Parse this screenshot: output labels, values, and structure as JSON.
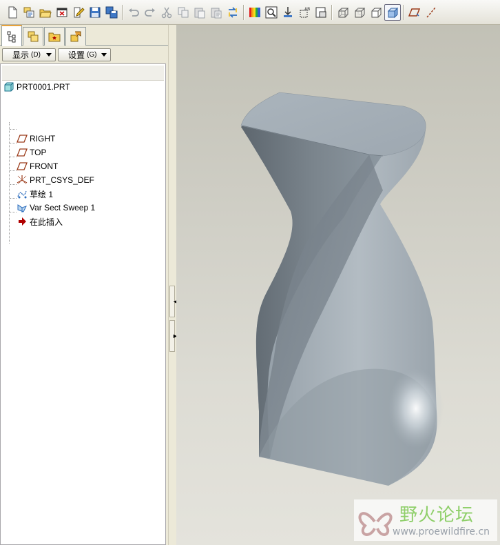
{
  "toolbar": {
    "buttons": [
      {
        "name": "new-icon"
      },
      {
        "name": "open-icon"
      },
      {
        "name": "open-folder-icon"
      },
      {
        "name": "close-window-icon"
      },
      {
        "name": "edit-icon"
      },
      {
        "name": "save-icon"
      },
      {
        "name": "save-copy-icon"
      },
      {
        "name": "undo-icon"
      },
      {
        "name": "redo-icon"
      },
      {
        "name": "cut-icon"
      },
      {
        "name": "copy-icon"
      },
      {
        "name": "paste-icon"
      },
      {
        "name": "paste-special-icon"
      },
      {
        "name": "regenerate-icon"
      },
      {
        "name": "color-appearance-icon"
      },
      {
        "name": "zoom-window-icon"
      },
      {
        "name": "zoom-in-icon"
      },
      {
        "name": "view-manager-icon"
      },
      {
        "name": "saved-views-icon"
      },
      {
        "name": "wireframe-icon"
      },
      {
        "name": "hidden-line-icon"
      },
      {
        "name": "no-hidden-icon"
      },
      {
        "name": "shading-icon",
        "active": true
      },
      {
        "name": "datum-plane-display-icon"
      }
    ]
  },
  "model_tree": {
    "tabs": [
      {
        "name": "model-tree-tab",
        "active": true
      },
      {
        "name": "folder-browser-tab"
      },
      {
        "name": "favorites-tab"
      },
      {
        "name": "connections-tab"
      }
    ],
    "show_button": {
      "label": "显示",
      "accel": "(D)"
    },
    "settings_button": {
      "label": "设置",
      "accel": "(G)"
    },
    "root": "PRT0001.PRT",
    "items": [
      {
        "label": "RIGHT",
        "icon": "datum-plane-icon"
      },
      {
        "label": "TOP",
        "icon": "datum-plane-icon"
      },
      {
        "label": "FRONT",
        "icon": "datum-plane-icon"
      },
      {
        "label": "PRT_CSYS_DEF",
        "icon": "csys-icon"
      },
      {
        "label": "草绘 1",
        "icon": "sketch-icon"
      },
      {
        "label": "Var Sect Sweep 1",
        "icon": "sweep-icon"
      },
      {
        "label": "在此插入",
        "icon": "insert-here-arrow-icon"
      }
    ]
  },
  "watermark": {
    "title": "野火论坛",
    "url": "www.proewildfire.cn"
  },
  "colors": {
    "model_surface": "#8e9aa3",
    "accent_tab": "#e8a23a",
    "insert_arrow": "#b00000",
    "watermark_green": "#8fcf6a"
  }
}
